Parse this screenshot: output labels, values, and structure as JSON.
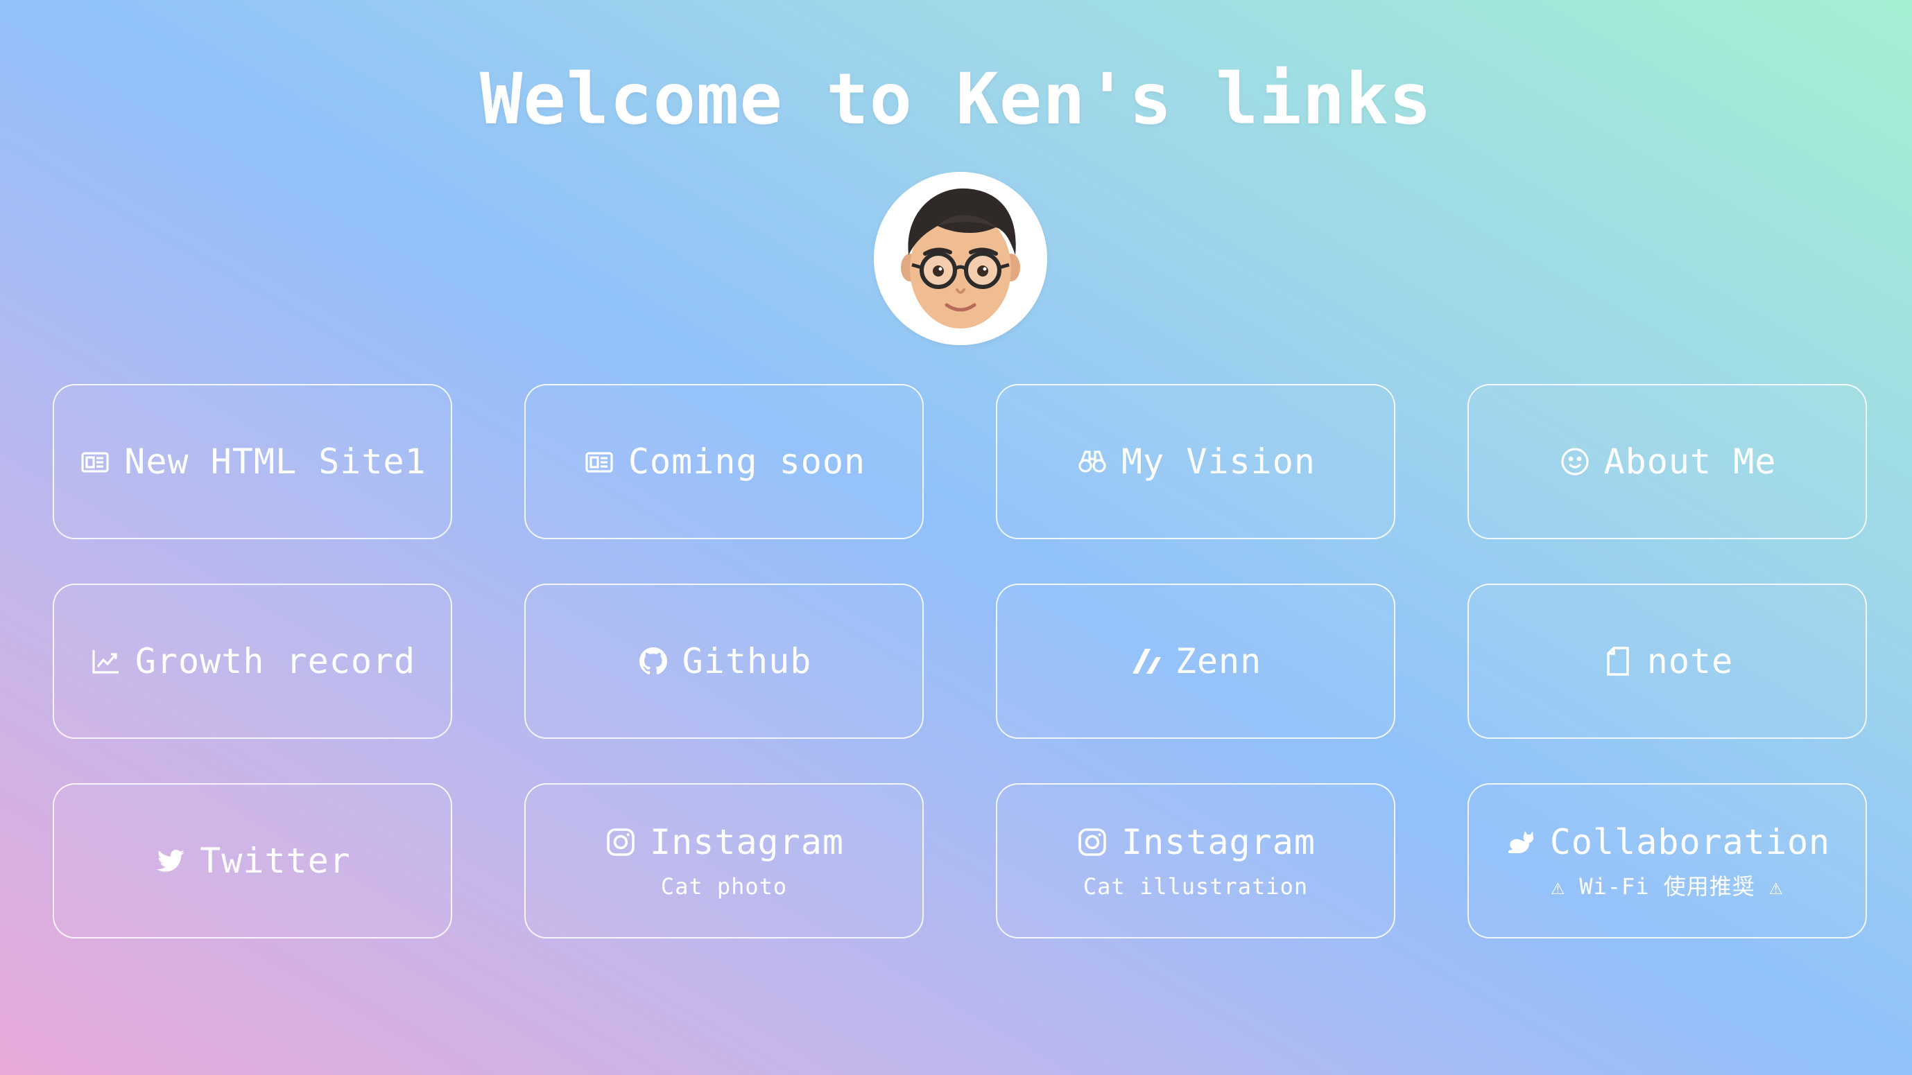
{
  "page": {
    "title": "Welcome to Ken's links"
  },
  "links": [
    {
      "label": "New HTML Site1",
      "icon": "newspaper-icon"
    },
    {
      "label": "Coming soon",
      "icon": "newspaper-icon"
    },
    {
      "label": "My Vision",
      "icon": "binoculars-icon"
    },
    {
      "label": "About Me",
      "icon": "smile-icon"
    },
    {
      "label": "Growth record",
      "icon": "chart-line-icon"
    },
    {
      "label": "Github",
      "icon": "github-icon"
    },
    {
      "label": "Zenn",
      "icon": "zenn-icon"
    },
    {
      "label": "note",
      "icon": "note-icon"
    },
    {
      "label": "Twitter",
      "icon": "twitter-icon"
    },
    {
      "label": "Instagram",
      "sub": "Cat photo",
      "icon": "instagram-icon"
    },
    {
      "label": "Instagram",
      "sub": "Cat illustration",
      "icon": "instagram-icon"
    },
    {
      "label": "Collaboration",
      "sub": "⚠ Wi-Fi 使用推奨 ⚠",
      "icon": "cat-icon"
    }
  ],
  "colors": {
    "text": "#ffffff",
    "gradient_pink": "#e8a9d8",
    "gradient_blue": "#91c0fb",
    "gradient_green": "#a4f0d2"
  }
}
